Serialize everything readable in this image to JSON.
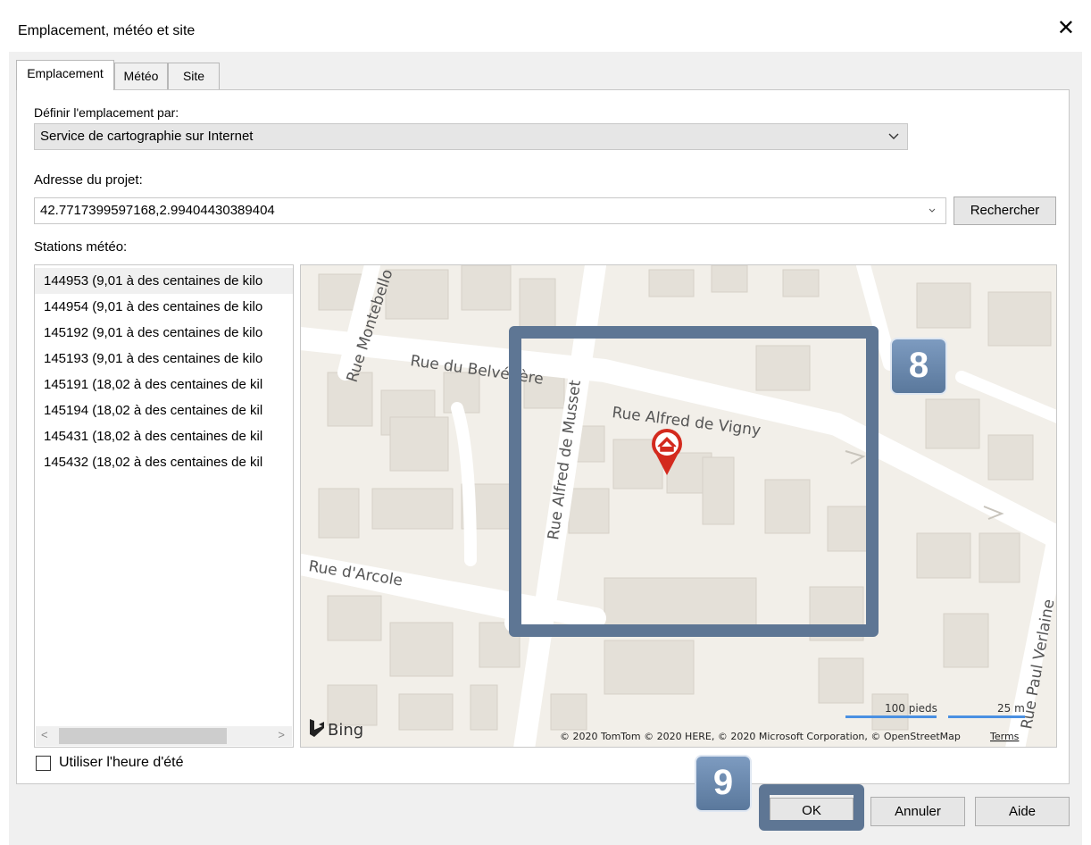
{
  "dialog": {
    "title": "Emplacement, météo et site",
    "close_glyph": "✕"
  },
  "tabs": [
    {
      "label": "Emplacement",
      "active": true
    },
    {
      "label": "Météo",
      "active": false
    },
    {
      "label": "Site",
      "active": false
    }
  ],
  "location": {
    "define_label": "Définir l'emplacement par:",
    "define_value": "Service de cartographie sur Internet",
    "address_label": "Adresse du projet:",
    "address_value": "42.7717399597168,2.99404430389404",
    "search_label": "Rechercher"
  },
  "stations": {
    "label": "Stations météo:",
    "items": [
      "144953 (9,01 à des centaines de kilo",
      "144954 (9,01 à des centaines de kilo",
      "145192 (9,01 à des centaines de kilo",
      "145193 (9,01 à des centaines de kilo",
      "145191 (18,02 à des centaines de kil",
      "145194 (18,02 à des centaines de kil",
      "145431 (18,02 à des centaines de kil",
      "145432 (18,02 à des centaines de kil"
    ],
    "scroll_left": "<",
    "scroll_right": ">"
  },
  "map": {
    "streets": {
      "montebello": "Rue Montebello",
      "belvedere": "Rue du Belvédère",
      "musset": "Rue Alfred de Musset",
      "vigny": "Rue Alfred de Vigny",
      "arcole": "Rue d'Arcole",
      "verlaine": "Rue Paul Verlaine"
    },
    "bing_label": "Bing",
    "scale_feet": "100 pieds",
    "scale_meters": "25 m",
    "copyright": "© 2020 TomTom © 2020 HERE, © 2020 Microsoft Corporation, © OpenStreetMap",
    "terms": "Terms"
  },
  "daylight_saving_label": "Utiliser l'heure d'été",
  "buttons": {
    "ok": "OK",
    "cancel": "Annuler",
    "help": "Aide"
  },
  "callouts": {
    "eight": "8",
    "nine": "9"
  },
  "colors": {
    "callout": "#5e7694",
    "pin": "#d32a1e",
    "map_bg": "#f2efe9",
    "building": "#e4e0d8",
    "road": "#ffffff"
  }
}
